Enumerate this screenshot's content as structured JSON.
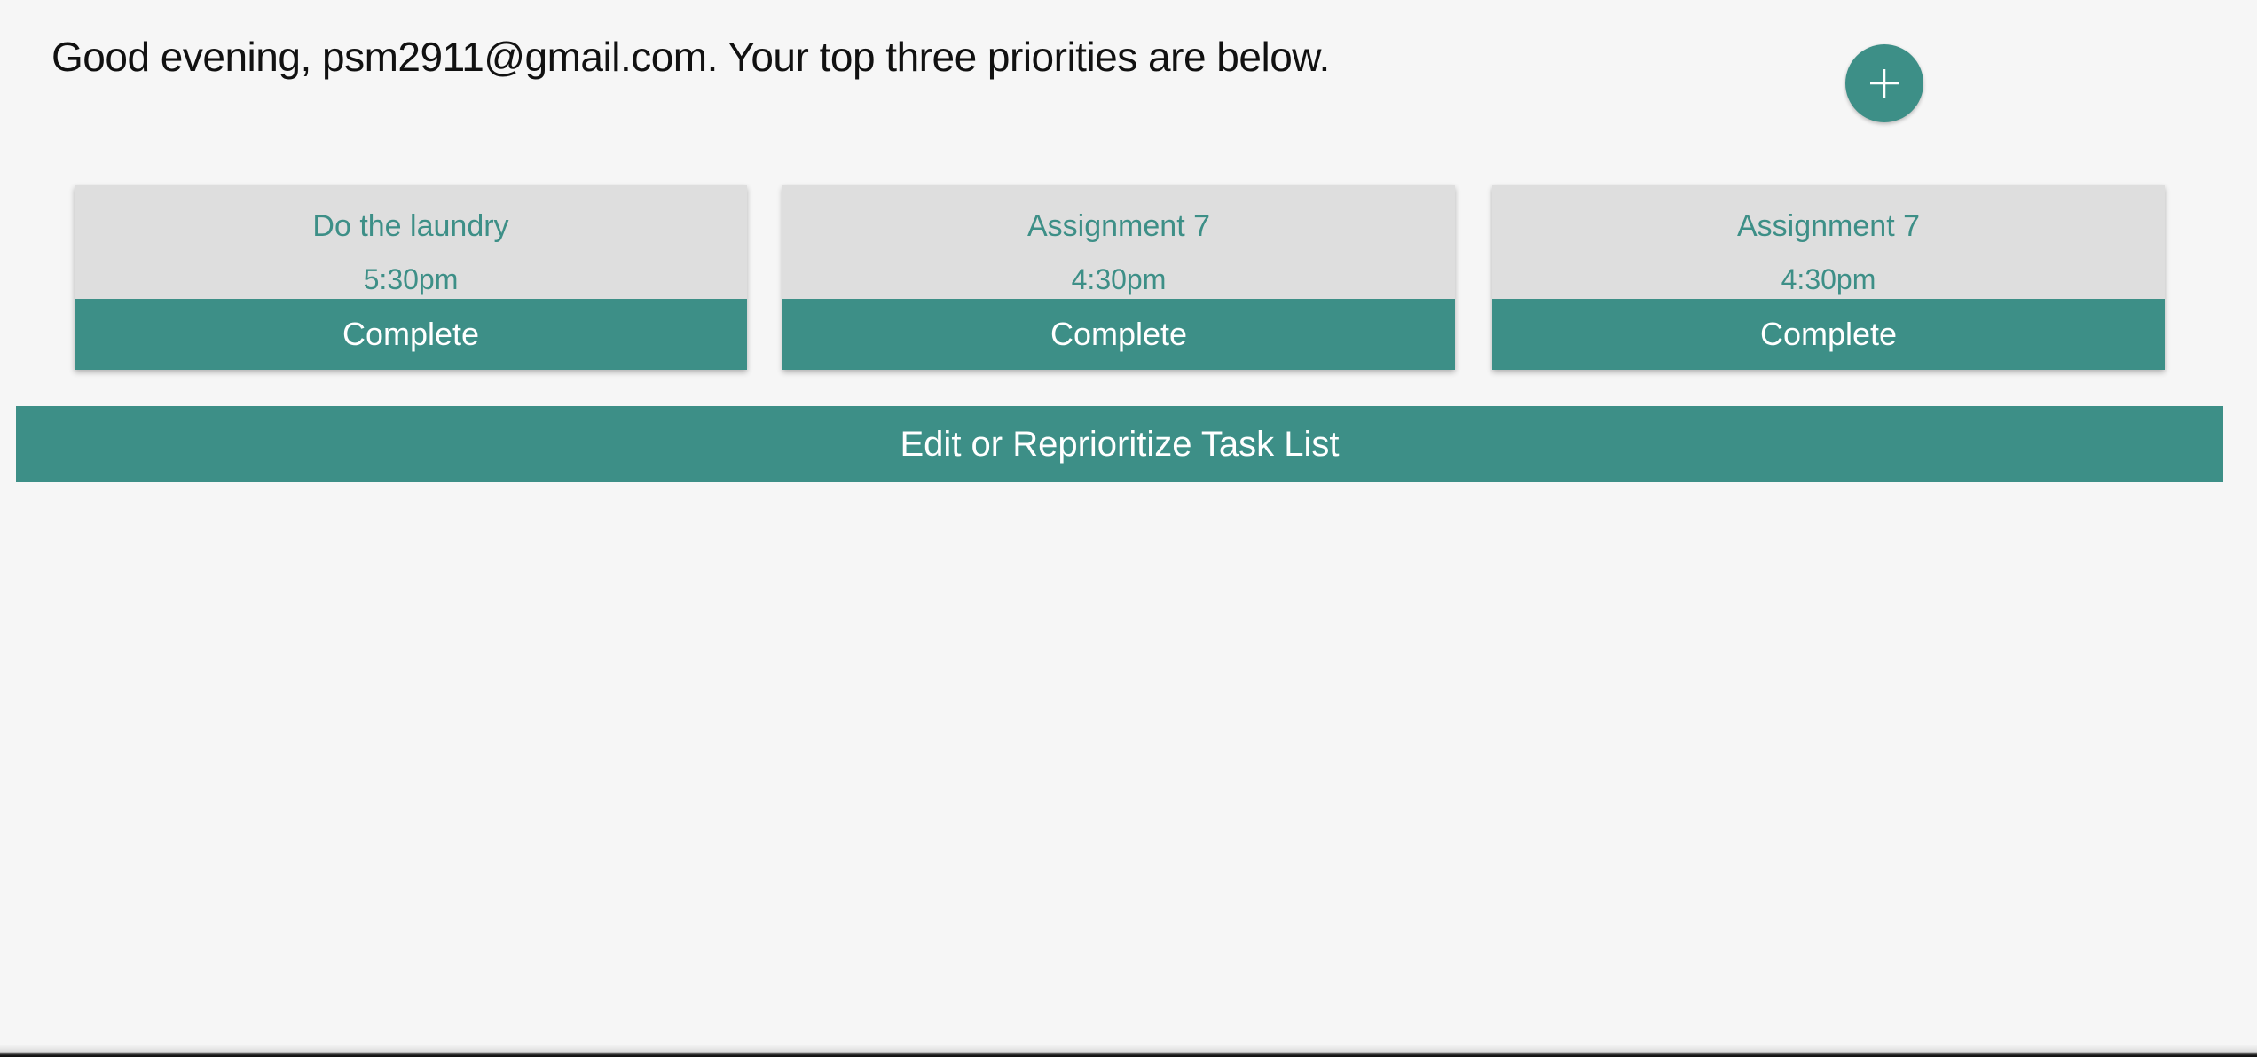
{
  "greeting": "Good evening, psm2911@gmail.com. Your top three priorities are below.",
  "add_button": {
    "icon": "plus-icon"
  },
  "tasks": [
    {
      "title": "Do the laundry",
      "time": "5:30pm",
      "action": "Complete"
    },
    {
      "title": "Assignment 7",
      "time": "4:30pm",
      "action": "Complete"
    },
    {
      "title": "Assignment 7",
      "time": "4:30pm",
      "action": "Complete"
    }
  ],
  "edit_button": "Edit or Reprioritize Task List",
  "colors": {
    "accent": "#3d8f87",
    "card_background": "#dedede",
    "page_background": "#f6f6f6"
  }
}
